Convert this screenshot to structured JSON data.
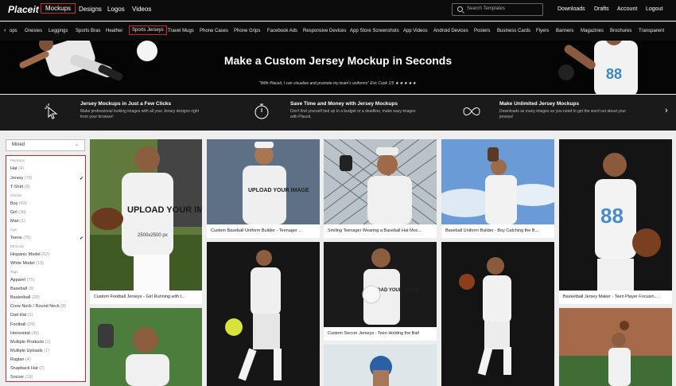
{
  "topnav": {
    "logo": "Placeit",
    "items": [
      "Mockups",
      "Designs",
      "Logos",
      "Videos"
    ],
    "search_placeholder": "Search Templates",
    "right_items": [
      "Downloads",
      "Drafts",
      "Account",
      "Logout"
    ]
  },
  "catbar": {
    "arrow": "‹",
    "items": [
      "ops",
      "Onesies",
      "Leggings",
      "Sports Bras",
      "Heather",
      "Sports Jerseys",
      "Travel Mugs",
      "Phone Cases",
      "Phone Grips",
      "Facebook Ads",
      "Responsive Devices",
      "App Store Screenshots",
      "App Videos",
      "Android Devices",
      "Posters",
      "Business Cards",
      "Flyers",
      "Banners",
      "Magazines",
      "Brochures",
      "Transparent"
    ],
    "active": "Sports Jerseys"
  },
  "hero": {
    "title": "Make a Custom Jersey Mockup in Seconds",
    "quote": "\"With Placeit, I can visualize and promote my team's uniforms\"  Eric Cook 1/5",
    "stars": "★★★★★",
    "jersey_number": "88"
  },
  "features": [
    {
      "title": "Jersey Mockups in Just a Few Clicks",
      "desc": "Make professional looking images with all your Jersey designs right from your browser!",
      "icon": "cursor-click-icon"
    },
    {
      "title": "Save Time and Money with Jersey Mockups",
      "desc": "Don't find yourself tied up to a budget or a deadline, make easy images with Placeit.",
      "icon": "stopwatch-icon"
    },
    {
      "title": "Make Unlimited Jersey Mockups",
      "desc": "Downloads as many images as you need to get the word out about your jerseys!",
      "icon": "infinity-icon"
    }
  ],
  "sidebar": {
    "sort_value": "Mixed",
    "groups": [
      {
        "label": "Mockups",
        "items": [
          {
            "name": "Hat",
            "count": "(4)"
          },
          {
            "name": "Jersey",
            "count": "(75)",
            "checked": true
          },
          {
            "name": "T-Shirt",
            "count": "(8)"
          }
        ]
      },
      {
        "label": "Gender",
        "items": [
          {
            "name": "Boy",
            "count": "(43)"
          },
          {
            "name": "Girl",
            "count": "(30)"
          },
          {
            "name": "Man",
            "count": "(1)"
          }
        ]
      },
      {
        "label": "Age",
        "items": [
          {
            "name": "Teens",
            "count": "(75)",
            "checked": true
          }
        ]
      },
      {
        "label": "Ethnicity",
        "items": [
          {
            "name": "Hispanic Model",
            "count": "(62)"
          },
          {
            "name": "White Model",
            "count": "(13)"
          }
        ]
      },
      {
        "label": "Tags",
        "items": [
          {
            "name": "Apparel",
            "count": "(75)"
          },
          {
            "name": "Baseball",
            "count": "(9)"
          },
          {
            "name": "Basketball",
            "count": "(20)"
          },
          {
            "name": "Crew Neck / Round Neck",
            "count": "(8)"
          },
          {
            "name": "Dad Hat",
            "count": "(1)"
          },
          {
            "name": "Football",
            "count": "(24)"
          },
          {
            "name": "Horizontal",
            "count": "(49)"
          },
          {
            "name": "Multiple Products",
            "count": "(1)"
          },
          {
            "name": "Multiple Uploads",
            "count": "(1)"
          },
          {
            "name": "Raglan",
            "count": "(4)"
          },
          {
            "name": "Snapback Hat",
            "count": "(2)"
          },
          {
            "name": "Soccer",
            "count": "(19)"
          }
        ]
      }
    ]
  },
  "grid": {
    "upload_text": "UPLOAD YOUR IMAGE",
    "upload_dims": "2500x2500 px",
    "number": "88",
    "cards": [
      {
        "caption": "Custom Football Jerseys - Girl Running with t..."
      },
      {
        "caption": "Custom Baseball Uniform Builder - Teenager ..."
      },
      {
        "caption": "Smiling Teenager Wearing a Baseball Hat Moc..."
      },
      {
        "caption": "Baseball Uniform Builder - Boy Catching the B..."
      },
      {
        "caption": "Basketball Jersey Maker - Teen Player Focusin..."
      },
      {
        "caption": ""
      },
      {
        "caption": ""
      },
      {
        "caption": "Custom Soccer Jerseys - Teen Holding the Ball"
      },
      {
        "caption": ""
      },
      {
        "caption": ""
      },
      {
        "caption": ""
      }
    ]
  }
}
